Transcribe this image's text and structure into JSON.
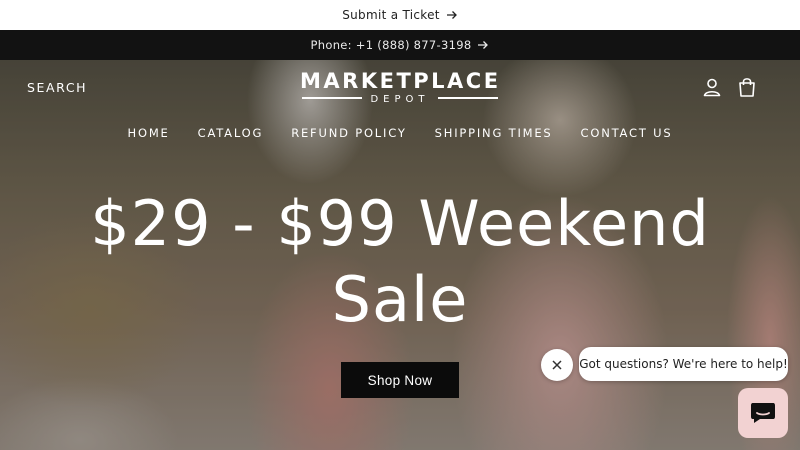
{
  "announcement": {
    "ticket_label": "Submit a Ticket",
    "phone_label": "Phone: +1 (888) 877-3198"
  },
  "header": {
    "search_label": "SEARCH",
    "logo_main": "MARKETPLACE",
    "logo_sub": "DEPOT",
    "icons": [
      "account-icon",
      "cart-icon"
    ]
  },
  "nav": {
    "items": [
      {
        "label": "HOME"
      },
      {
        "label": "CATALOG"
      },
      {
        "label": "REFUND POLICY"
      },
      {
        "label": "SHIPPING TIMES"
      },
      {
        "label": "CONTACT US"
      }
    ]
  },
  "hero": {
    "headline_line1": "$29 - $99 Weekend",
    "headline_line2": "Sale",
    "cta_label": "Shop Now"
  },
  "chat": {
    "bubble_text": "Got questions? We're here to help!",
    "launcher_color": "#f2d2d2",
    "icons": [
      "close-icon",
      "chat-icon"
    ]
  },
  "colors": {
    "announcement_dark": "#121212",
    "cta_background": "#0b0b0b"
  }
}
